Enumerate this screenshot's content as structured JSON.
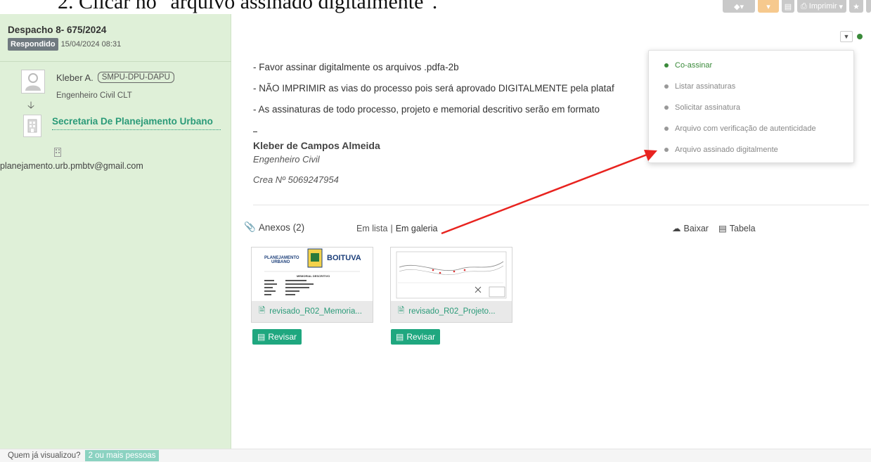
{
  "caption": {
    "text": "2.  Clicar no \"arquivo assinado digitalmente\"."
  },
  "toolbar": {
    "print_label": "Imprimir"
  },
  "document": {
    "title": "Despacho 8- 675/2024",
    "status": "Respondido",
    "datetime": "15/04/2024 08:31"
  },
  "sender": {
    "name": "Kleber A.",
    "unit": "SMPU-DPU-DAPU",
    "role": "Engenheiro Civil CLT"
  },
  "destination": {
    "name": "Secretaria De Planejamento Urbano",
    "email": "planejamento.urb.pmbtv@gmail.com"
  },
  "body": {
    "lines": [
      " - Favor assinar digitalmente os arquivos .pdfa-2b",
      "- NÃO IMPRIMIR as vias do processo pois será aprovado DIGITALMENTE pela plataf",
      "- As assinaturas de todo processo, projeto e memorial descritivo serão em formato"
    ],
    "signature_name": "Kleber de Campos Almeida",
    "signature_role": "Engenheiro Civil",
    "signature_crea": "Crea Nº 5069247954"
  },
  "attachments": {
    "heading": "Anexos (2)",
    "view_list": "Em lista",
    "view_separator": "|",
    "view_gallery": "Em galeria",
    "download_label": "Baixar",
    "table_label": "Tabela",
    "files": [
      {
        "name": "revisado_R02_Memoria...",
        "review_label": "Revisar"
      },
      {
        "name": "revisado_R02_Projeto...",
        "review_label": "Revisar"
      }
    ]
  },
  "thumb1": {
    "logo_left_1": "PLANEJAMENTO",
    "logo_left_2": "URBANO",
    "logo_right": "BOITUVA",
    "doc_heading": "MEMORIAL DESCRITIVO"
  },
  "signature_menu": {
    "items": [
      {
        "label": "Co-assinar",
        "color": "#3a8a3a"
      },
      {
        "label": "Listar assinaturas",
        "color": "#999999"
      },
      {
        "label": "Solicitar assinatura",
        "color": "#999999"
      },
      {
        "label": "Arquivo com verificação de autenticidade",
        "color": "#999999"
      },
      {
        "label": "Arquivo assinado digitalmente",
        "color": "#999999"
      }
    ]
  },
  "footer": {
    "question": "Quem já visualizou?",
    "badge": "2 ou mais pessoas"
  },
  "colors": {
    "panel_green": "#dff0d8",
    "accent_teal": "#1fa77f",
    "annotation_red": "#e8231f"
  }
}
